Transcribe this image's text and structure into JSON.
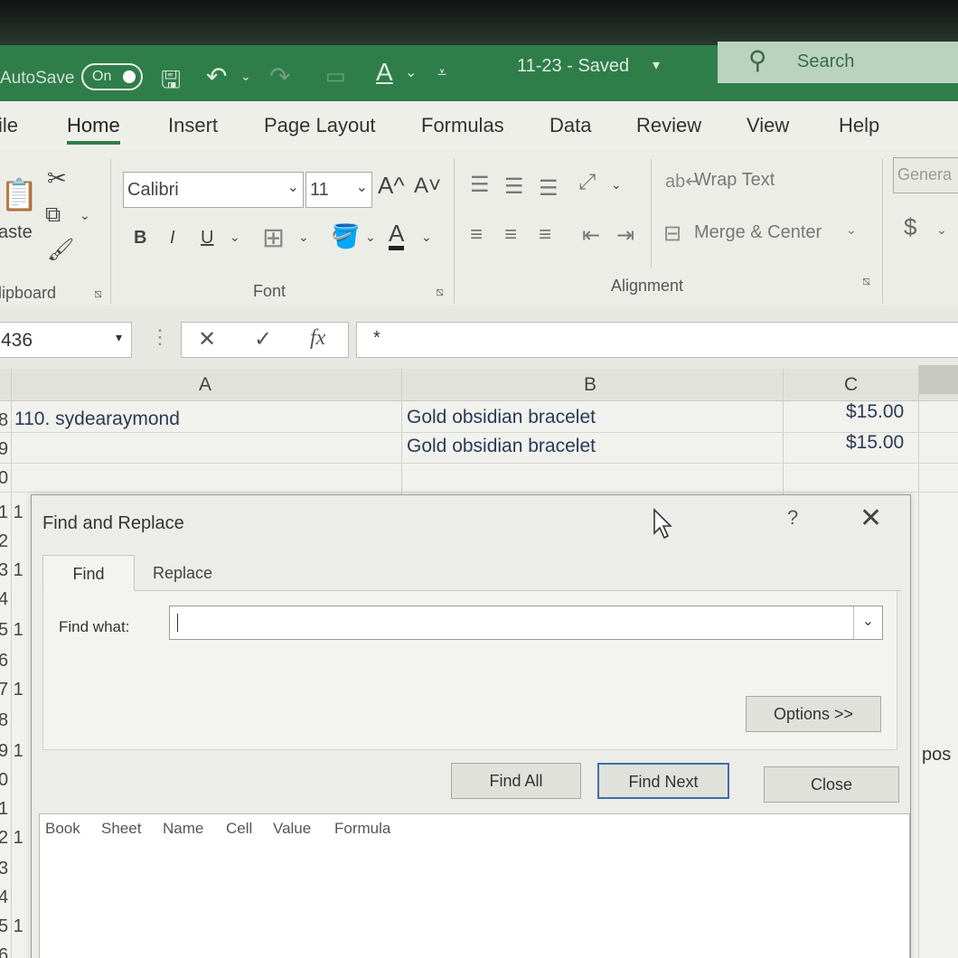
{
  "titlebar": {
    "autosave_label": "AutoSave",
    "autosave_state": "On",
    "document_title": "11-23  -  Saved",
    "search_placeholder": "Search"
  },
  "menu": {
    "tabs": [
      "ile",
      "Home",
      "Insert",
      "Page Layout",
      "Formulas",
      "Data",
      "Review",
      "View",
      "Help"
    ],
    "active": "Home"
  },
  "ribbon": {
    "clipboard": {
      "paste_label": "aste",
      "group_label": "lipboard"
    },
    "font": {
      "name": "Calibri",
      "size": "11",
      "bold": "B",
      "italic": "I",
      "underline": "U",
      "grow": "A^",
      "shrink": "A˅",
      "group_label": "Font"
    },
    "alignment": {
      "wrap_text": "Wrap Text",
      "merge_center": "Merge & Center",
      "group_label": "Alignment"
    },
    "number": {
      "format": "Genera",
      "currency": "$"
    }
  },
  "formula_bar": {
    "name_box": "436",
    "cancel": "✕",
    "enter": "✓",
    "fx": "fx",
    "content": "*"
  },
  "grid": {
    "columns": [
      "A",
      "B",
      "C"
    ],
    "rows": [
      {
        "num": "8",
        "a": "110. sydearaymond",
        "b": "Gold obsidian bracelet",
        "c": "$15.00"
      },
      {
        "num": "9",
        "a": "",
        "b": "Gold obsidian bracelet",
        "c": "$15.00"
      },
      {
        "num": "0",
        "a": "",
        "b": "",
        "c": ""
      }
    ],
    "left_row_fragments": [
      "1 1",
      "2",
      "3 1",
      "4",
      "5 1",
      "6",
      "7 1",
      "8",
      "9 1",
      "0",
      "1",
      "2 1",
      "3",
      "4",
      "5 1",
      "6"
    ],
    "right_fragment": "pos"
  },
  "dialog": {
    "title": "Find and Replace",
    "help": "?",
    "close": "✕",
    "tabs": [
      "Find",
      "Replace"
    ],
    "active_tab": "Find",
    "find_what_label": "Find what:",
    "find_what_value": "",
    "options_button": "Options >>",
    "find_all_button": "Find All",
    "find_next_button": "Find Next",
    "close_button": "Close",
    "result_columns": [
      "Book",
      "Sheet",
      "Name",
      "Cell",
      "Value",
      "Formula"
    ]
  },
  "colors": {
    "excel_green": "#2f7e4a",
    "focus_blue": "#3e6fa8",
    "cell_text": "#2a3a56"
  }
}
